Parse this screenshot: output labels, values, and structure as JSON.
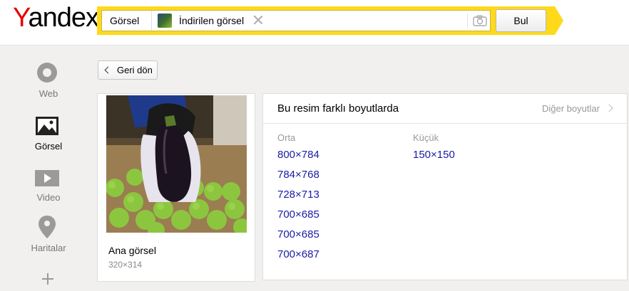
{
  "logo": {
    "first_letter": "Y",
    "rest": "andex"
  },
  "search": {
    "category_tag": "Görsel",
    "image_tag": "İndirilen görsel",
    "button_label": "Bul",
    "accent_color": "#ffd91a"
  },
  "back_button": "Geri dön",
  "sidebar": {
    "items": [
      {
        "label": "Web",
        "icon": "web-icon"
      },
      {
        "label": "Görsel",
        "icon": "image-icon",
        "active": true
      },
      {
        "label": "Video",
        "icon": "video-icon"
      },
      {
        "label": "Haritalar",
        "icon": "map-pin-icon"
      },
      {
        "label": "",
        "icon": "plus-icon"
      }
    ]
  },
  "main_card": {
    "title": "Ana görsel",
    "size": "320×314"
  },
  "sizes_card": {
    "title": "Bu resim farklı boyutlarda",
    "more_link": "Diğer boyutlar",
    "columns": [
      {
        "label": "Orta",
        "sizes": [
          "800×784",
          "784×768",
          "728×713",
          "700×685",
          "700×685",
          "700×687"
        ]
      },
      {
        "label": "Küçük",
        "sizes": [
          "150×150"
        ]
      }
    ],
    "link_color": "#1a1aa6"
  }
}
